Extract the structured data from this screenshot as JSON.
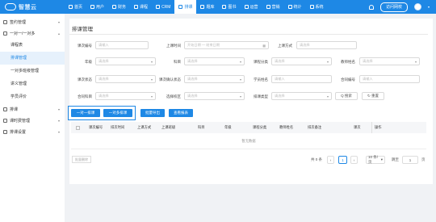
{
  "brand": {
    "logo_text": "智慧云"
  },
  "nav": [
    {
      "label": "首页",
      "icon": "home-icon"
    },
    {
      "label": "用户",
      "icon": "user-icon"
    },
    {
      "label": "财务",
      "icon": "finance-icon"
    },
    {
      "label": "课程",
      "icon": "course-icon"
    },
    {
      "label": "CRM",
      "icon": "crm-icon"
    },
    {
      "label": "排课",
      "icon": "schedule-icon"
    },
    {
      "label": "题库",
      "icon": "question-bank-icon"
    },
    {
      "label": "图书",
      "icon": "book-icon"
    },
    {
      "label": "运营",
      "icon": "operation-icon"
    },
    {
      "label": "营销",
      "icon": "marketing-icon"
    },
    {
      "label": "统计",
      "icon": "stats-icon"
    },
    {
      "label": "系统",
      "icon": "system-icon"
    }
  ],
  "header": {
    "visit_label": "访问网校"
  },
  "sidebar": {
    "groups": [
      {
        "label": "签约管理",
        "chev": "▾"
      },
      {
        "label": "一对一/一对多",
        "chev": "▴"
      }
    ],
    "items": [
      "课程表",
      "排课管理",
      "一对多班级管理",
      "讲义管理",
      "学员评价"
    ],
    "bottom_groups": [
      {
        "label": "排课",
        "chev": "▾"
      },
      {
        "label": "课时费管理",
        "chev": "▾"
      },
      {
        "label": "排课设置",
        "chev": "▾"
      }
    ]
  },
  "page": {
    "title": "排课管理"
  },
  "filters": {
    "row1": [
      {
        "label": "课次编号",
        "placeholder": "请输入"
      },
      {
        "label": "上课时间",
        "placeholder": "开始日期 — 结束日期"
      },
      {
        "label": "上课方式",
        "placeholder": "请选择"
      }
    ],
    "row2": [
      {
        "label": "年级",
        "placeholder": "请选择"
      },
      {
        "label": "科目",
        "placeholder": "请选择"
      },
      {
        "label": "课程分类",
        "placeholder": "请选择"
      },
      {
        "label": "教师姓名",
        "placeholder": "请选择"
      }
    ],
    "row3": [
      {
        "label": "课次状态",
        "placeholder": "请选择"
      },
      {
        "label": "课次确认状态",
        "placeholder": "请选择"
      },
      {
        "label": "学员姓名",
        "placeholder": "请输入"
      },
      {
        "label": "合同编号",
        "placeholder": "请输入"
      }
    ],
    "row4": [
      {
        "label": "合同科目",
        "placeholder": "请选择"
      },
      {
        "label": "选择校区",
        "placeholder": "请选择"
      },
      {
        "label": "排课类型",
        "placeholder": "请选择"
      }
    ],
    "search_label": "Q 搜索",
    "reset_label": "↻ 重置"
  },
  "actions": {
    "one_on_one": "一对一排课",
    "one_to_many": "一对多排课",
    "batch_export": "批量导出",
    "view_summary": "查看报表"
  },
  "table": {
    "columns": [
      "课次编号",
      "排次时间",
      "上课方式",
      "上课班级",
      "科目",
      "年级",
      "课程分类",
      "教师姓名",
      "排次备注",
      "课次",
      "操作"
    ],
    "empty_text": "暂无数据"
  },
  "footer": {
    "bulk_label": "批量删除",
    "total": "共 0 条",
    "current_page": "1",
    "page_size": "10 条/页",
    "jump_label": "跳至",
    "jump_value": "1",
    "jump_suffix": "页"
  }
}
